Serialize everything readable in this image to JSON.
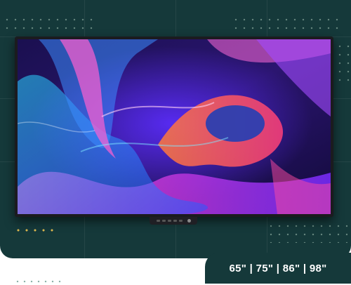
{
  "product": {
    "sizes_label": "65\" | 75\" | 86\" | 98\""
  },
  "colors": {
    "panel_background": "#15393a",
    "bezel": "#1b1b1f",
    "accent_dots": "#e6be50"
  },
  "screen": {
    "wallpaper": "abstract-fluid-wave"
  }
}
